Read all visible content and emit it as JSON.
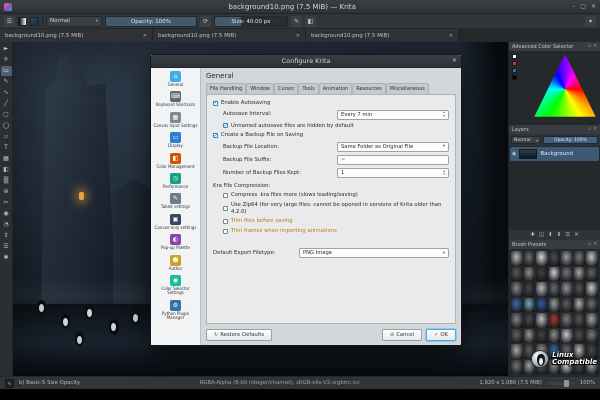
{
  "window": {
    "title": "background10.png (7.5 MiB) — Krita"
  },
  "icons": {
    "close": "✕",
    "minimize": "–",
    "maximize": "▢",
    "dropdown": "▾",
    "spin_up": "▴",
    "spin_down": "▾",
    "reload": "⟳",
    "check": "✓",
    "cancel": "⊘",
    "restore": "↻",
    "eye": "◉",
    "add": "✚",
    "duplicate": "◫",
    "move_up": "⬆",
    "move_down": "⬇",
    "properties": "☰",
    "float": "▫",
    "menu": "☰",
    "brush": "✎",
    "eraser": "◧",
    "wave": "∿"
  },
  "toolbar": {
    "blend_mode": "Normal",
    "opacity_label": "Opacity: 100%",
    "size_label": "Size: 40.00 px"
  },
  "doc_tabs": [
    "background10.png (7.5 MiB)",
    "background10.png (7.5 MiB)",
    "background10.png (7.5 MiB)"
  ],
  "toolbox_tools": [
    "►",
    "✛",
    "▭",
    "✎",
    "∿",
    "╱",
    "▢",
    "◯",
    "▱",
    "T",
    "▦",
    "◧",
    "▒",
    "⊕",
    "✂",
    "◉",
    "◔",
    "⇕",
    "☰",
    "✱"
  ],
  "dialog": {
    "title": "Configure Krita",
    "sidebar": [
      {
        "label": "General",
        "glyph": "⌂",
        "color": "#3daee9"
      },
      {
        "label": "Keyboard Shortcuts",
        "glyph": "⌨",
        "color": "#5f6a72"
      },
      {
        "label": "Canvas Input Settings",
        "glyph": "▦",
        "color": "#7d8a93"
      },
      {
        "label": "Display",
        "glyph": "▭",
        "color": "#2d7dd2"
      },
      {
        "label": "Color Management",
        "glyph": "◧",
        "color": "#d35400"
      },
      {
        "label": "Performance",
        "glyph": "◷",
        "color": "#16a085"
      },
      {
        "label": "Tablet settings",
        "glyph": "✎",
        "color": "#6c7a89"
      },
      {
        "label": "Canvas-only settings",
        "glyph": "▣",
        "color": "#34495e"
      },
      {
        "label": "Pop-up Palette",
        "glyph": "◐",
        "color": "#8e44ad"
      },
      {
        "label": "Author",
        "glyph": "☻",
        "color": "#c9a227"
      },
      {
        "label": "Color Selector Settings",
        "glyph": "◉",
        "color": "#1abc9c"
      },
      {
        "label": "Python Plugin Manager",
        "glyph": "⚙",
        "color": "#3572a5"
      }
    ],
    "tabs": [
      "File Handling",
      "Window",
      "Cursor",
      "Tools",
      "Animation",
      "Resources",
      "Miscellaneous"
    ],
    "general": {
      "heading": "General",
      "autosave_label": "Enable Autosaving",
      "interval_label": "Autosave Interval:",
      "interval_value": "Every 7 min",
      "hidden_autosave_label": "Unnamed autosave files are hidden by default",
      "backup_label": "Create a Backup File on Saving",
      "backup_location_label": "Backup File Location:",
      "backup_location_value": "Same Folder as Original File",
      "backup_suffix_label": "Backup File Suffix:",
      "backup_suffix_value": "~",
      "backup_count_label": "Number of Backup Files Kept:",
      "backup_count_value": "1",
      "compression_group": "Kra File Compression:",
      "compress_label": "Compress .kra files more (slows loading/saving)",
      "zip64_label": "Use Zip64 (for very large files: cannot be opened in versions of Krita older than 4.2.0)",
      "trim_label": "Trim files before saving",
      "trim2_label": "Trim frames when importing animations",
      "export_label": "Default Export Filetype:",
      "export_value": "PNG Image"
    },
    "checks": {
      "autosave": true,
      "hidden_autosave": true,
      "backup": true,
      "compress": false,
      "zip64": false,
      "trim": false,
      "trim2": false
    },
    "buttons": {
      "restore": "Restore Defaults",
      "cancel": "Cancel",
      "ok": "OK"
    }
  },
  "docks": {
    "color_selector": {
      "title": "Advanced Color Selector"
    },
    "layers": {
      "title": "Layers",
      "blend_mode": "Normal",
      "opacity": "Opacity: 100%",
      "layer_name": "Background"
    },
    "brush_presets": {
      "title": "Brush Presets",
      "cells": [
        "#b8b8b8",
        "#6e6e6e",
        "#d6d6d6",
        "#4f4f4f",
        "#9b9b9b",
        "#7a7a7a",
        "#c4c4c4",
        "#5a5a5a",
        "#8f8f8f",
        "#3f3f3f",
        "#cfcfcf",
        "#777777",
        "#a8a8a8",
        "#616161",
        "#8a8a8a",
        "#474747",
        "#bdbdbd",
        "#6b6b6b",
        "#959595",
        "#545454",
        "#c9c9c9",
        "#3d6f9f",
        "#7fa8c9",
        "#2e5f93",
        "#9c9c9c",
        "#5d5d5d",
        "#b1b1b1",
        "#6f6f6f",
        "#868686",
        "#4b4b4b",
        "#c1c1c1",
        "#a33b2e",
        "#7d7d7d",
        "#585858",
        "#a5a5a5",
        "#636363",
        "#989898",
        "#434343",
        "#8d8d8d",
        "#cbcbcb",
        "#515151",
        "#7b7b7b",
        "#ababab",
        "#5f5f5f",
        "#929292",
        "#3a6ea5",
        "#6a6a6a",
        "#bcbcbc",
        "#484848",
        "#747474",
        "#a1a1a1",
        "#565656",
        "#8b8b8b",
        "#c6c6c6",
        "#4d4d4d",
        "#9f9f9f"
      ]
    }
  },
  "statusbar": {
    "brush_name": "b) Basic-5 Size Opacity",
    "colorspace": "RGBA-Alpha (8-bit integer/channel), sRGB-elle-V2-srgbtrc.icc",
    "canvas_size": "1,920 x 1,080 (7.5 MiB)",
    "zoom": "100%"
  },
  "watermark": {
    "line1": "Linux",
    "line2": "Compatible"
  }
}
